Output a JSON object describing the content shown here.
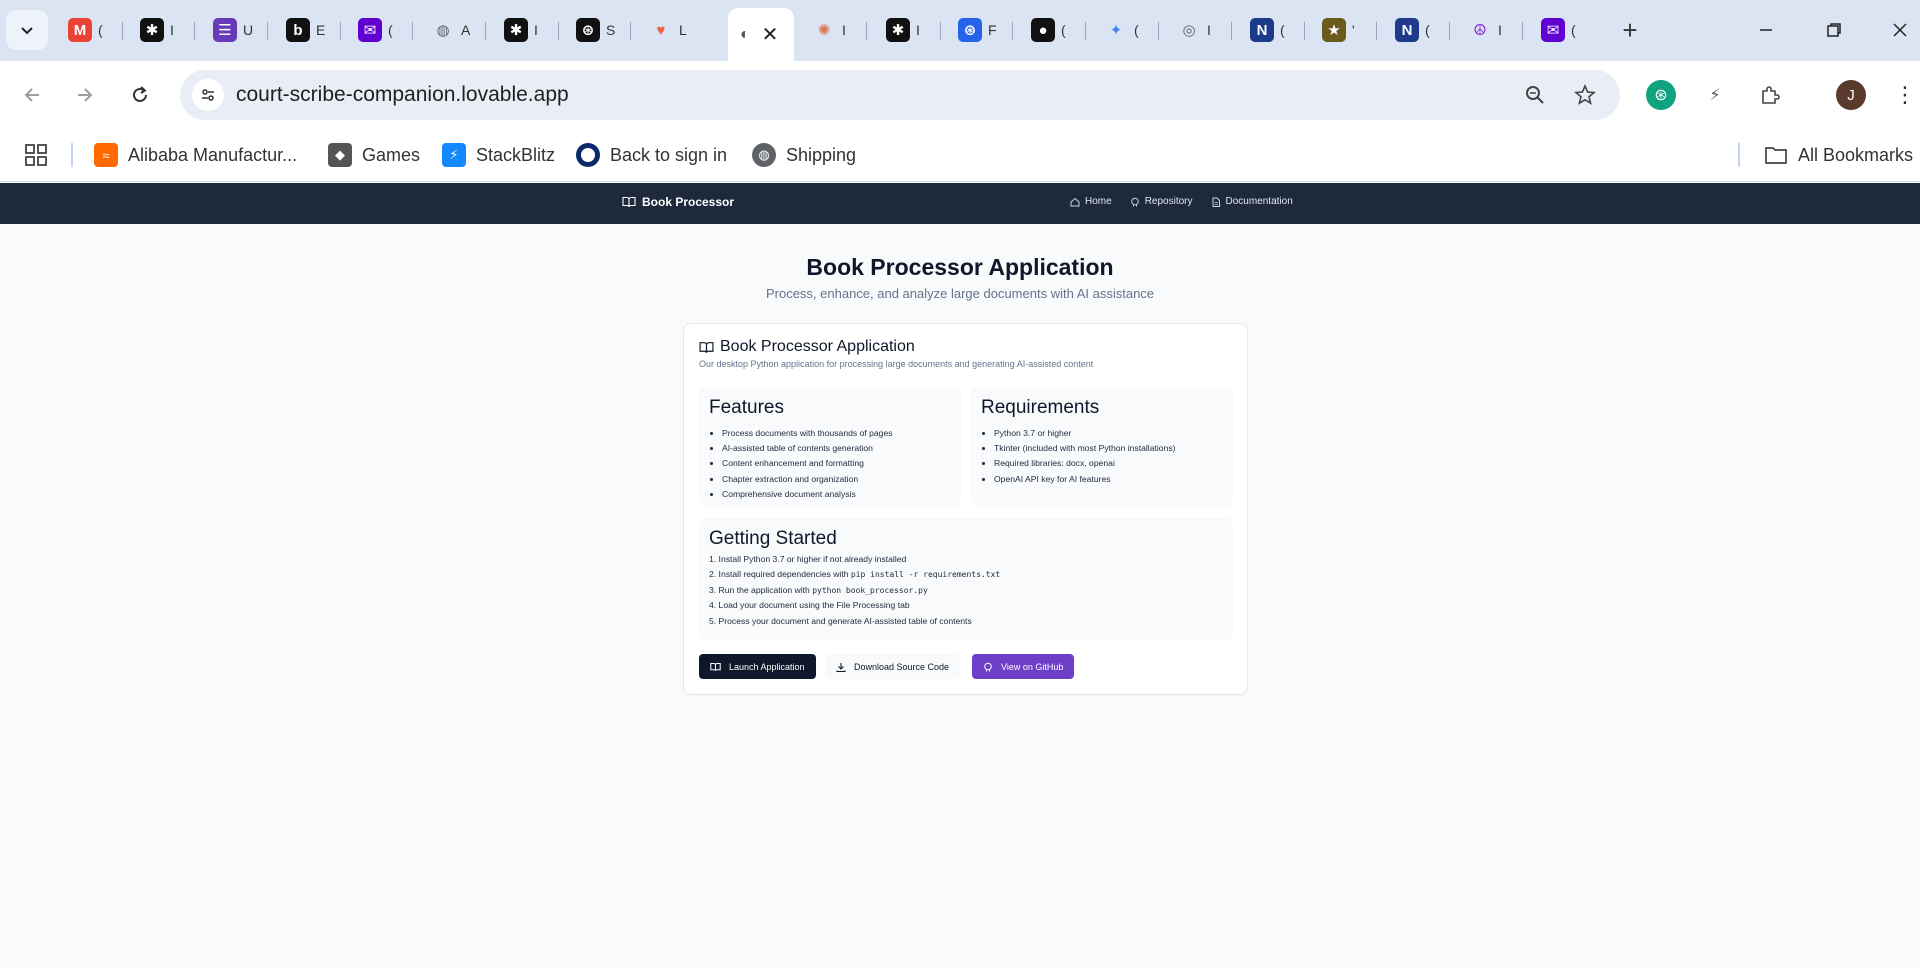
{
  "browser": {
    "tabs": [
      {
        "icon": "gmail-icon",
        "title": "(",
        "color": "#ea4335",
        "glyph": "M"
      },
      {
        "icon": "perplexity-icon",
        "title": "I",
        "color": "#111111",
        "glyph": "✱"
      },
      {
        "icon": "forms-icon",
        "title": "U",
        "color": "#673ab7",
        "glyph": "☰"
      },
      {
        "icon": "bolt-b-icon",
        "title": "E",
        "color": "#111111",
        "glyph": "b"
      },
      {
        "icon": "mail-icon",
        "title": "(",
        "color": "#6001d2",
        "glyph": "✉"
      },
      {
        "icon": "globe-icon",
        "title": "A",
        "color": "#5f6368",
        "glyph": "◍"
      },
      {
        "icon": "perplexity-icon",
        "title": "I",
        "color": "#111111",
        "glyph": "✱"
      },
      {
        "icon": "openai-icon",
        "title": "S",
        "color": "#111111",
        "glyph": "⊛"
      },
      {
        "icon": "lovable-heart-icon",
        "title": "L",
        "color": "#f25f3a",
        "glyph": "♥"
      },
      {
        "icon": "claude-icon",
        "title": "I",
        "color": "#d97757",
        "glyph": "✺"
      },
      {
        "icon": "perplexity-icon",
        "title": "I",
        "color": "#111111",
        "glyph": "✱"
      },
      {
        "icon": "openai-blue-icon",
        "title": "F",
        "color": "#2563eb",
        "glyph": "⊛"
      },
      {
        "icon": "github-icon",
        "title": "(",
        "color": "#111111",
        "glyph": "●"
      },
      {
        "icon": "gemini-icon",
        "title": "(",
        "color": "#4285f4",
        "glyph": "✦"
      },
      {
        "icon": "chrome-icon",
        "title": "I",
        "color": "#5f6368",
        "glyph": "◎"
      },
      {
        "icon": "notion-n-icon",
        "title": "(",
        "color": "#1e3a8a",
        "glyph": "N"
      },
      {
        "icon": "star-badge-icon",
        "title": "'",
        "color": "#6b5a1e",
        "glyph": "★"
      },
      {
        "icon": "notion-n-icon",
        "title": "(",
        "color": "#1e3a8a",
        "glyph": "N"
      },
      {
        "icon": "peace-icon",
        "title": "I",
        "color": "#7e22ce",
        "glyph": "☮"
      },
      {
        "icon": "mail-icon",
        "title": "(",
        "color": "#6001d2",
        "glyph": "✉"
      }
    ],
    "active_tab": {
      "icon": "lovable-icon",
      "title": "(",
      "close": "✕"
    },
    "url": "court-scribe-companion.lovable.app",
    "profile_initial": "J",
    "bookmarks": [
      {
        "label": "Alibaba Manufactur...",
        "icon": "alibaba-icon",
        "color": "#ff6a00"
      },
      {
        "label": "Games",
        "icon": "roblox-icon",
        "color": "#555555"
      },
      {
        "label": "StackBlitz",
        "icon": "stackblitz-icon",
        "color": "#1389fd"
      },
      {
        "label": "Back to sign in",
        "icon": "ring-icon",
        "color": "#0b2a6b"
      },
      {
        "label": "Shipping",
        "icon": "globe-icon",
        "color": "#5f6368"
      }
    ],
    "all_bookmarks": "All Bookmarks"
  },
  "app": {
    "brand": "Book Processor",
    "nav": [
      {
        "label": "Home",
        "icon": "home-icon"
      },
      {
        "label": "Repository",
        "icon": "github-icon"
      },
      {
        "label": "Documentation",
        "icon": "document-icon"
      }
    ],
    "title": "Book Processor Application",
    "subtitle": "Process, enhance, and analyze large documents with AI assistance",
    "card": {
      "title": "Book Processor Application",
      "description": "Our desktop Python application for processing large documents and generating AI-assisted content",
      "features": {
        "heading": "Features",
        "items": [
          "Process documents with thousands of pages",
          "AI-assisted table of contents generation",
          "Content enhancement and formatting",
          "Chapter extraction and organization",
          "Comprehensive document analysis"
        ]
      },
      "requirements": {
        "heading": "Requirements",
        "items": [
          "Python 3.7 or higher",
          "Tkinter (included with most Python installations)",
          "Required libraries: docx, openai",
          "OpenAI API key for AI features"
        ]
      },
      "getting_started": {
        "heading": "Getting Started",
        "steps": [
          {
            "text": "1. Install Python 3.7 or higher if not already installed",
            "code": ""
          },
          {
            "text": "2. Install required dependencies with ",
            "code": "pip install -r requirements.txt"
          },
          {
            "text": "3. Run the application with ",
            "code": "python book_processor.py"
          },
          {
            "text": "4. Load your document using the File Processing tab",
            "code": ""
          },
          {
            "text": "5. Process your document and generate AI-assisted table of contents",
            "code": ""
          }
        ]
      },
      "buttons": {
        "launch": "Launch Application",
        "download": "Download Source Code",
        "github": "View on GitHub"
      }
    }
  }
}
